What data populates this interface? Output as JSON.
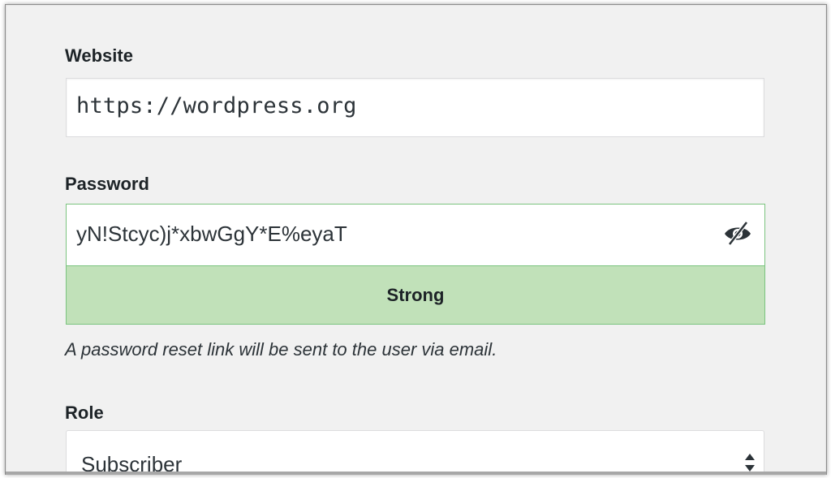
{
  "form": {
    "website": {
      "label": "Website",
      "value": "https://wordpress.org"
    },
    "password": {
      "label": "Password",
      "value": "yN!Stcyc)j*xbwGgY*E%eyaT",
      "visibility_icon": "eye-slash-icon",
      "strength_label": "Strong",
      "strength_color": "#c1e1b9",
      "border_color": "#7bc47f"
    },
    "hint": "A password reset link will be sent to the user via email.",
    "role": {
      "label": "Role",
      "selected": "Subscriber",
      "arrow_icon": "select-arrows-icon"
    }
  }
}
